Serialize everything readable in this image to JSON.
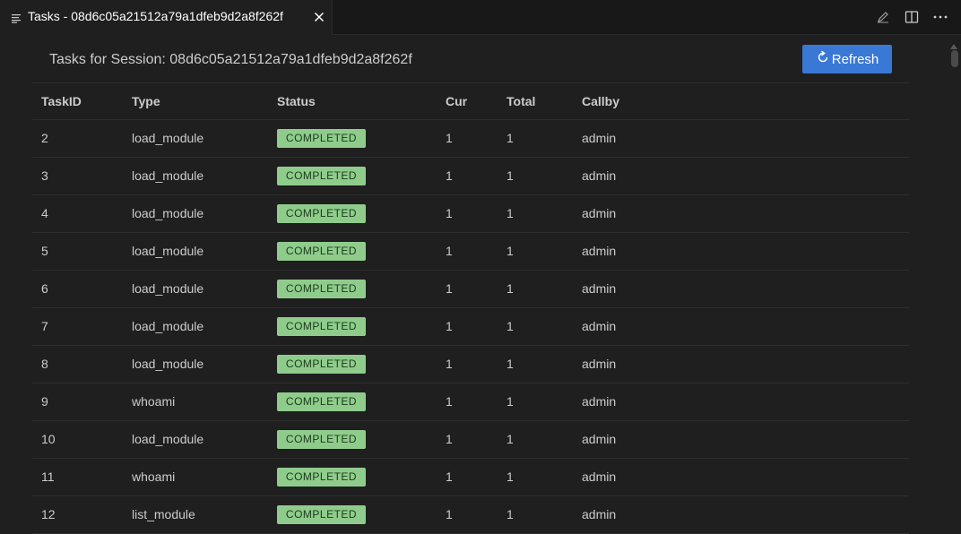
{
  "tab": {
    "title": "Tasks - 08d6c05a21512a79a1dfeb9d2a8f262f"
  },
  "header": {
    "title": "Tasks for Session: 08d6c05a21512a79a1dfeb9d2a8f262f",
    "refresh_label": "Refresh"
  },
  "colors": {
    "accent": "#3a78d6",
    "completed": "#8fcc8c"
  },
  "table": {
    "columns": [
      "TaskID",
      "Type",
      "Status",
      "Cur",
      "Total",
      "Callby"
    ],
    "rows": [
      [
        "2",
        "load_module",
        "COMPLETED",
        "1",
        "1",
        "admin"
      ],
      [
        "3",
        "load_module",
        "COMPLETED",
        "1",
        "1",
        "admin"
      ],
      [
        "4",
        "load_module",
        "COMPLETED",
        "1",
        "1",
        "admin"
      ],
      [
        "5",
        "load_module",
        "COMPLETED",
        "1",
        "1",
        "admin"
      ],
      [
        "6",
        "load_module",
        "COMPLETED",
        "1",
        "1",
        "admin"
      ],
      [
        "7",
        "load_module",
        "COMPLETED",
        "1",
        "1",
        "admin"
      ],
      [
        "8",
        "load_module",
        "COMPLETED",
        "1",
        "1",
        "admin"
      ],
      [
        "9",
        "whoami",
        "COMPLETED",
        "1",
        "1",
        "admin"
      ],
      [
        "10",
        "load_module",
        "COMPLETED",
        "1",
        "1",
        "admin"
      ],
      [
        "11",
        "whoami",
        "COMPLETED",
        "1",
        "1",
        "admin"
      ],
      [
        "12",
        "list_module",
        "COMPLETED",
        "1",
        "1",
        "admin"
      ]
    ]
  }
}
